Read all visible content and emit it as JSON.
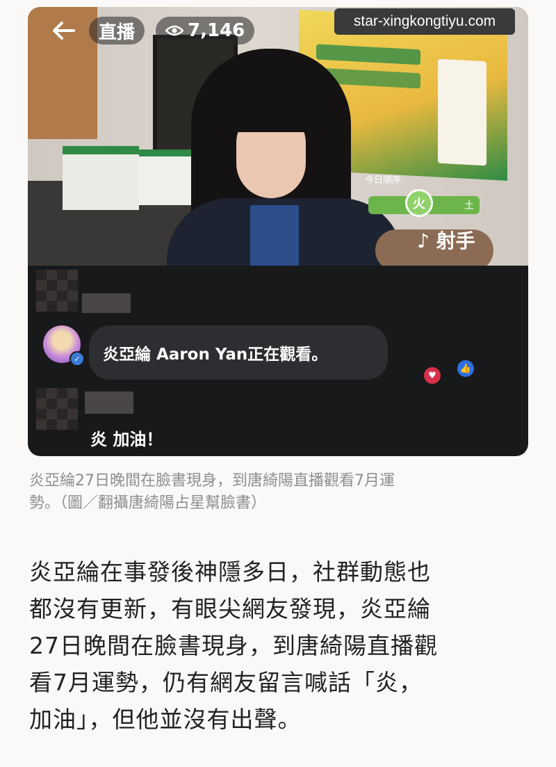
{
  "live": {
    "live_label": "直播",
    "viewer_count": "7,146",
    "watermark": "star-xingkongtiyu.com",
    "overlay": {
      "schedule_label": "今日順序",
      "element_badge": "火",
      "earth_label": "土",
      "sign_label": "射手"
    }
  },
  "comments": {
    "join_notice": "炎亞綸 Aaron Yan正在觀看。",
    "comment_text": "炎 加油！"
  },
  "caption": {
    "line1": "炎亞綸27日晚間在臉書現身，到唐綺陽直播觀看7月運",
    "line2": "勢。（圖／翻攝唐綺陽占星幫臉書）"
  },
  "article": {
    "line1": "炎亞綸在事發後神隱多日，社群動態也",
    "line2": "都沒有更新，有眼尖網友發現，炎亞綸",
    "line3": "27日晚間在臉書現身，到唐綺陽直播觀",
    "line4": "看7月運勢，仍有網友留言喊話「炎，",
    "line5": "加油」，但他並沒有出聲。"
  },
  "colors": {
    "card_bg": "#18191b",
    "caption_gray": "#8e8e8e",
    "text_dark": "#222222",
    "overlay_green": "#6db54b"
  },
  "icons": [
    "back-arrow-icon",
    "eye-icon",
    "heart-reaction-icon",
    "like-reaction-icon",
    "verified-icon"
  ]
}
